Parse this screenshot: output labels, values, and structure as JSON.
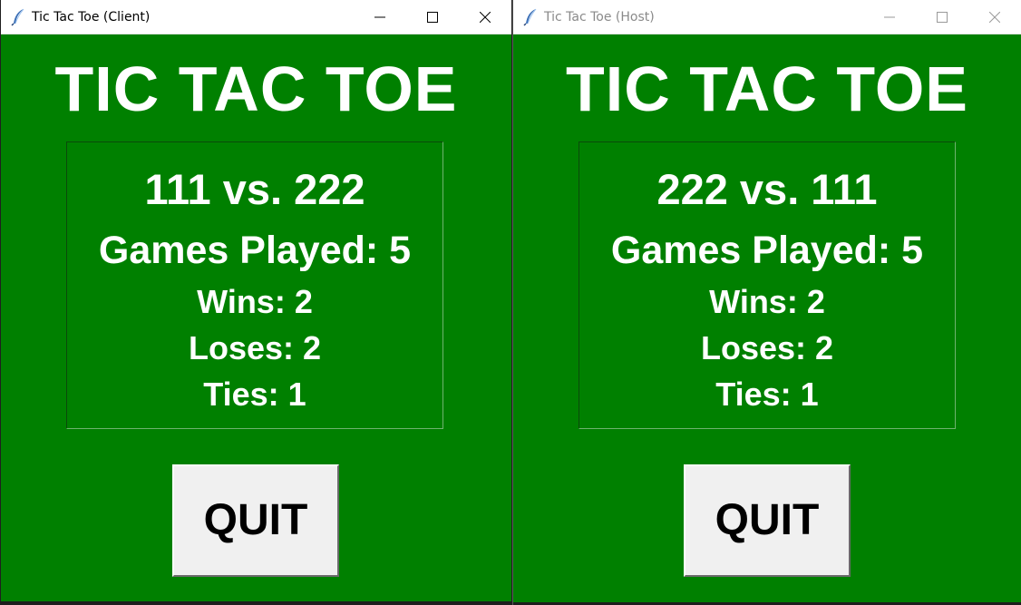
{
  "windows": {
    "client": {
      "title": "Tic Tac Toe (Client)",
      "heading": "TIC TAC TOE",
      "matchup": "111 vs. 222",
      "games_played": "Games Played: 5",
      "wins": "Wins: 2",
      "loses": "Loses: 2",
      "ties": "Ties: 1",
      "quit_label": "QUIT",
      "state": "active"
    },
    "host": {
      "title": "Tic Tac Toe (Host)",
      "heading": "TIC TAC TOE",
      "matchup": "222 vs. 111",
      "games_played": "Games Played: 5",
      "wins": "Wins: 2",
      "loses": "Loses: 2",
      "ties": "Ties: 1",
      "quit_label": "QUIT",
      "state": "inactive"
    }
  },
  "icons": {
    "app": "feather-icon",
    "minimize": "minimize-icon",
    "maximize": "maximize-icon",
    "close": "close-icon"
  },
  "colors": {
    "background_green": "#008000",
    "text_white": "#ffffff",
    "button_face": "#f0f0f0"
  }
}
